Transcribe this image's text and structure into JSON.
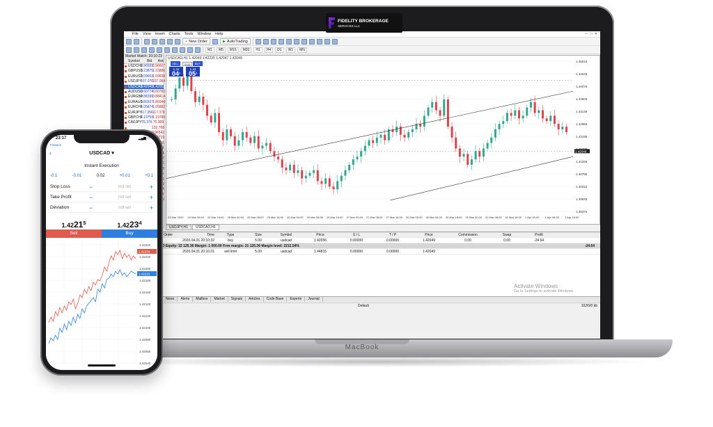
{
  "brand": {
    "name": "FIDELITY BROKERAGE",
    "sub": "SERVICES LLC"
  },
  "menu": [
    "File",
    "View",
    "Insert",
    "Charts",
    "Tools",
    "Window",
    "Help"
  ],
  "toolbar": {
    "new_order": "New Order",
    "auto_trading": "AutoTrading",
    "timeframes": [
      "M1",
      "M5",
      "M15",
      "M30",
      "H1",
      "H4",
      "D1",
      "W1",
      "MN"
    ]
  },
  "market_watch": {
    "title": "Market Watch: 20:10:23",
    "headers": [
      "Symbol",
      "Bid",
      "Ask"
    ],
    "rows": [
      [
        "USDCHF",
        "0.96599",
        "0.96607"
      ],
      [
        "GBPUSD",
        "1.23875",
        "1.23886"
      ],
      [
        "EURUSD",
        "1.09603",
        "1.09608"
      ],
      [
        "USDJPY",
        "107.076",
        "107.084"
      ],
      [
        "USDCAD",
        "1.42049",
        "1.42053"
      ],
      [
        "AUDUSD",
        "0.60774",
        "0.60782"
      ],
      [
        "EURGBP",
        "0.88399",
        "0.88414"
      ],
      [
        "EURAUD",
        "1.80327",
        "1.80344"
      ],
      [
        "EURCHF",
        "1.05874",
        "1.05882"
      ],
      [
        "EURJPY",
        "117.356",
        "117.370"
      ],
      [
        "GBPCHF",
        "1.19759",
        "1.19780"
      ],
      [
        "CADJPY",
        "75.376",
        "75.389"
      ],
      [
        "",
        "",
        "132.768"
      ],
      [
        "",
        "",
        "0.96542"
      ],
      [
        "",
        "",
        "1.00719"
      ],
      [
        "",
        "",
        "1.35600"
      ],
      [
        "",
        "",
        "85.089"
      ],
      [
        "",
        "",
        "118.854"
      ],
      [
        "",
        "",
        "1.65227"
      ],
      [
        "",
        "",
        "1.66836"
      ],
      [
        "",
        "",
        "0.66658"
      ],
      [
        "",
        "",
        "65.375"
      ],
      [
        "",
        "",
        "0.59186"
      ],
      [
        "",
        "",
        "0.86349"
      ],
      [
        "",
        "",
        "0.59724"
      ],
      [
        "",
        "",
        "65.050"
      ],
      [
        "",
        "",
        "1.02739"
      ]
    ]
  },
  "chart": {
    "title": "USDCAD,H1  1.42049 1.42225 1.42047 1.42049",
    "sell_label": "SELL",
    "buy_label": "BUY",
    "lot": "5.00",
    "sell_price_small": "1.42",
    "sell_price_big": "04",
    "sell_price_sup": "9",
    "buy_price_small": "1.42",
    "buy_price_big": "05",
    "buy_price_sup": "3",
    "price_labels": [
      "1.45015",
      "1.44545",
      "1.44075",
      "1.43605",
      "1.43135",
      "1.42665",
      "1.42195",
      "1.41725",
      "1.41255",
      "1.40785",
      "1.40315",
      "1.39845",
      "1.39375"
    ],
    "current_price": "1.42049",
    "date_labels": [
      "23 Mar 2020",
      "24 Mar 08:00",
      "24 Mar 16:00",
      "25 Mar 00:00",
      "25 Mar 08:00",
      "25 Mar 16:00",
      "26 Mar 00:00",
      "26 Mar 08:00",
      "26 Mar 16:00",
      "27 Mar 00:00",
      "27 Mar 08:00",
      "27 Mar 16:00",
      "30 Mar 00:00",
      "30 Mar 08:00",
      "30 Mar 16:00",
      "31 Mar 00:00",
      "31 Mar 08:00",
      "31 Mar 16:00",
      "1 Apr 00:00",
      "1 Apr 08:00",
      "1 Apr 16:00"
    ],
    "tabs": [
      "USDJPY,H1",
      "USDCAD,H1"
    ],
    "active_tab": 1
  },
  "terminal": {
    "headers": [
      "Order",
      "Time",
      "Type",
      "Size",
      "Symbol",
      "Price",
      "S / L",
      "T / P",
      "Price",
      "Commission",
      "Swap",
      "Profit"
    ],
    "rows": [
      [
        "",
        "2020.04.01 20:10:32",
        "buy",
        "5.00",
        "usdcad",
        "1.42056",
        "0.00000",
        "0.00000",
        "1.42049",
        "0.00",
        "0.00",
        "-24.64"
      ]
    ],
    "summary": "Balance: 22 150.00 USD  Equity: 22 125.36  Margin: 1 000.00  Free margin: 21 125.36  Margin level: 2212.54%",
    "summary_profit": "-24.64",
    "pending": [
      "",
      "2020.04.01 20:10:21",
      "sell limit",
      "5.00",
      "usdcad",
      "1.44815",
      "0.00000",
      "0.00000",
      "1.42049",
      "",
      "",
      ""
    ],
    "tabs": [
      "Account History",
      "News",
      "Alerts",
      "Mailbox",
      "Market",
      "Signals",
      "Articles",
      "Code Base",
      "Experts",
      "Journal"
    ]
  },
  "status": {
    "profile": "Default",
    "traffic": "102/0/0 kb"
  },
  "watermark": {
    "line1": "Activate Windows",
    "line2": "Go to Settings to activate Windows."
  },
  "laptop_label": "MacBook",
  "phone": {
    "time": "23:17",
    "back_app": "Finance",
    "symbol": "USDCAD",
    "mode": "Instant Execution",
    "steps": [
      "-0.1",
      "-0.01",
      "0.02",
      "+0.01",
      "+0.1"
    ],
    "stop_loss": "Stop Loss",
    "take_profit": "Take Profit",
    "deviation": "Deviation",
    "not_set": "not set",
    "sell_price": "1.42",
    "sell_price_big": "21",
    "sell_price_sup": "5",
    "buy_price": "1.42",
    "buy_price_big": "23",
    "buy_price_sup": "4",
    "sell": "Sell",
    "buy": "Buy",
    "price_labels": [
      "1.42240",
      "1.42220",
      "1.42200",
      "1.42180",
      "1.42160",
      "1.42140",
      "1.42120",
      "1.42100",
      "1.42080",
      "1.42060",
      "1.42040"
    ],
    "current_ask": "1.42234",
    "current_bid": "1.42215"
  },
  "colors": {
    "bull": "#2fa88f",
    "bear": "#e0414a",
    "accent": "#1f3fb6"
  }
}
